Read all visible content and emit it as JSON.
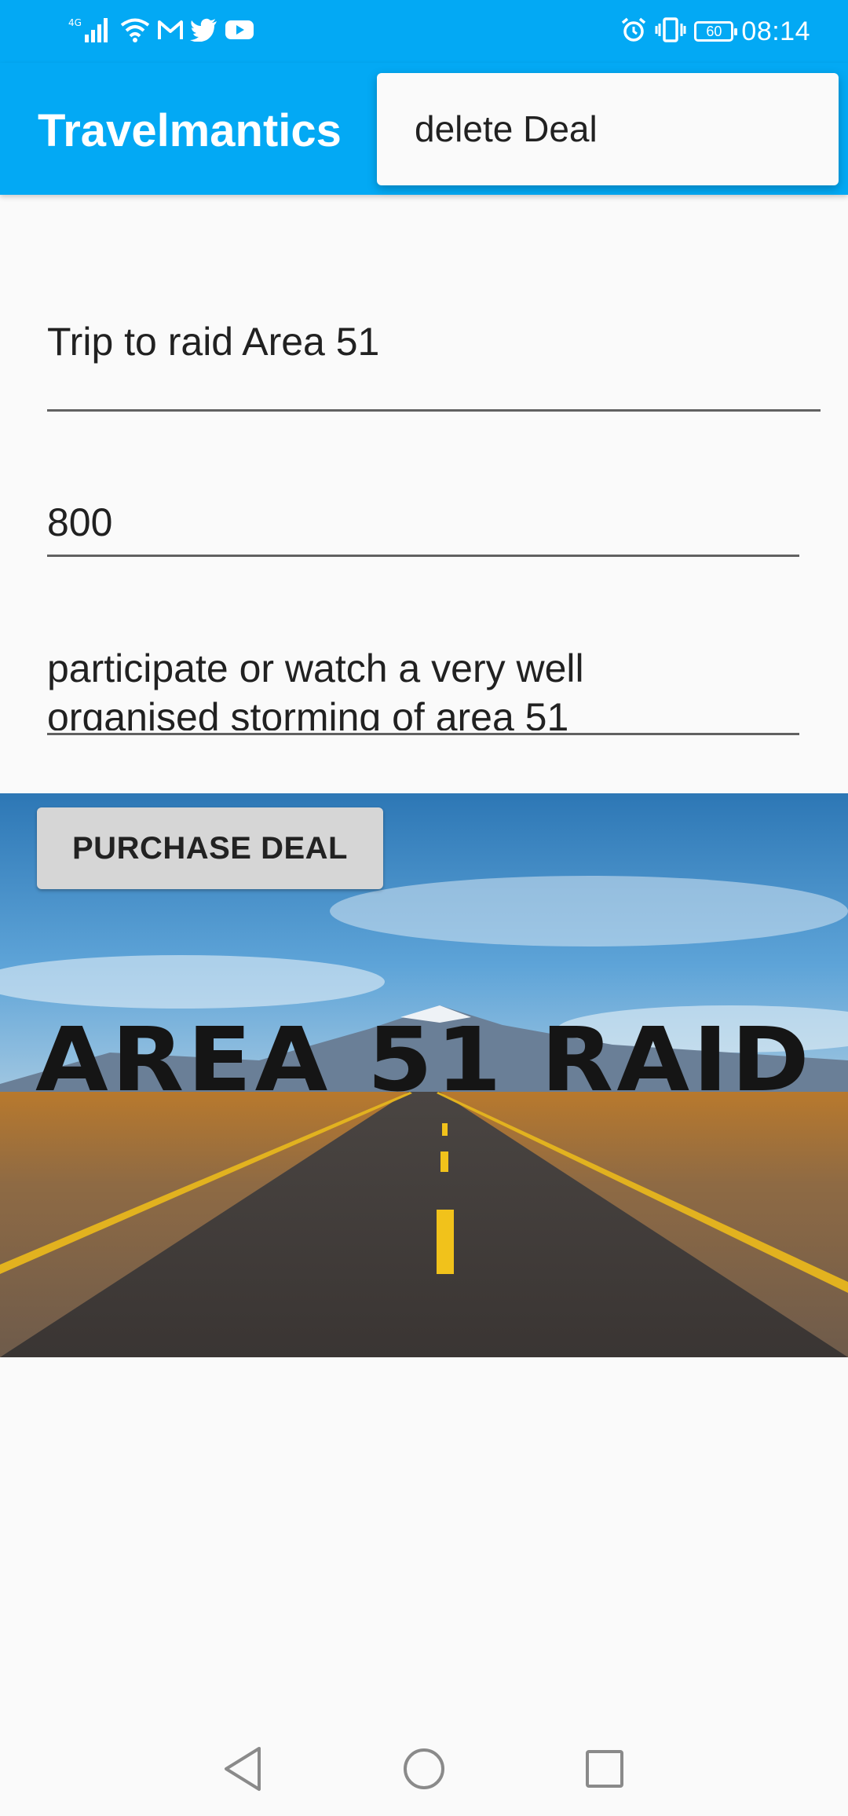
{
  "status_bar": {
    "time": "08:14",
    "battery": "60",
    "network": "4G",
    "left_icons": [
      "signal-icon",
      "wifi-icon",
      "gmail-icon",
      "twitter-icon",
      "youtube-icon"
    ],
    "right_icons": [
      "alarm-icon",
      "vibrate-icon",
      "battery-icon"
    ]
  },
  "app_bar": {
    "title": "Travelmantics",
    "background": "#03a9f4"
  },
  "overflow_menu": {
    "items": [
      {
        "label": "delete Deal"
      }
    ]
  },
  "form": {
    "title": "Trip to raid Area 51",
    "price": "800",
    "description_line1": "participate or watch a very well",
    "description_line2": "organised storming of area 51"
  },
  "purchase_button": {
    "label": "PURCHASE DEAL"
  },
  "deal_image": {
    "text": "AREA 51 RAID"
  },
  "nav_bar": {
    "icons": [
      "back-icon",
      "home-icon",
      "recents-icon"
    ]
  }
}
